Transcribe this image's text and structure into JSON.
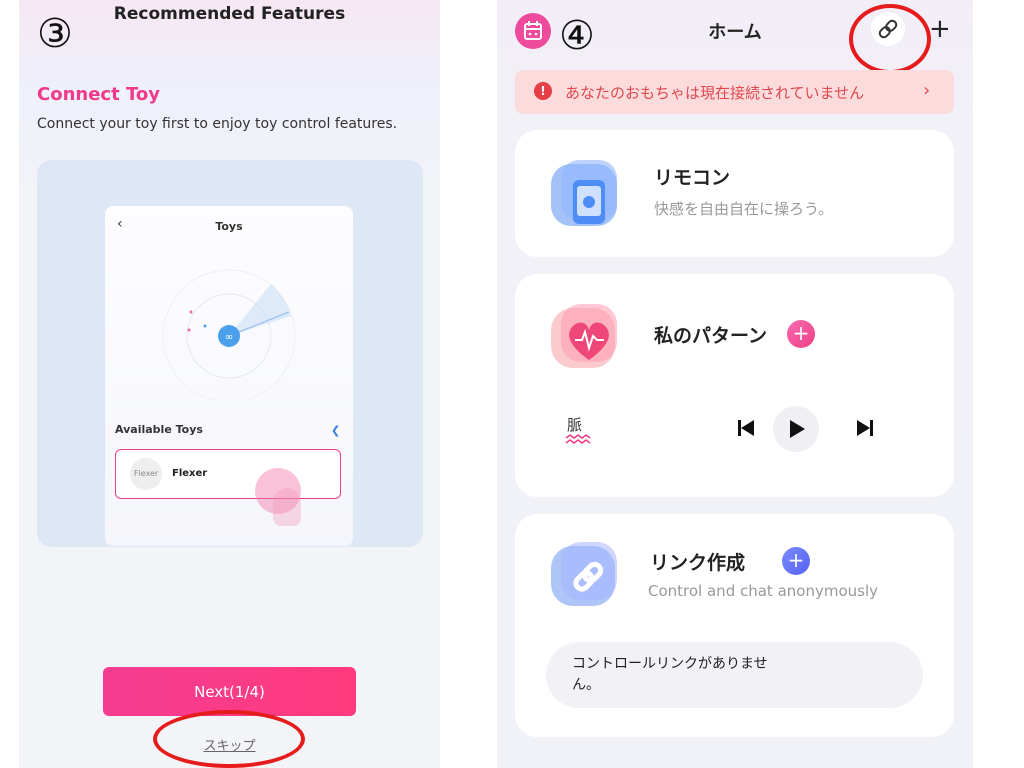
{
  "left": {
    "step_marker": "③",
    "header_title": "Recommended Features",
    "feature_title": "Connect Toy",
    "feature_desc": "Connect your toy first to enjoy toy control features.",
    "illustration": {
      "screen_title": "Toys",
      "available_label": "Available Toys",
      "toy_avatar": "Flexer",
      "toy_name": "Flexer"
    },
    "next_label": "Next(1/4)",
    "skip_label": "スキップ"
  },
  "right": {
    "step_marker": "④",
    "header_title": "ホーム",
    "alert_text": "あなたのおもちゃは現在接続されていません",
    "alert_icon": "!",
    "cards": {
      "remote": {
        "title": "リモコン",
        "subtitle": "快感を自由自在に操ろう。"
      },
      "pattern": {
        "title": "私のパターン",
        "pattern_label": "脈"
      },
      "link": {
        "title": "リンク作成",
        "subtitle": "Control and chat anonymously",
        "empty_text": "コントロールリンクがありません。"
      }
    },
    "icons": [
      "calendar-icon",
      "link-icon",
      "plus-icon",
      "chevron-right-icon",
      "previous-icon",
      "play-icon",
      "next-icon",
      "wave-icon"
    ]
  },
  "colors": {
    "accent_pink": "#f0398a",
    "alert_red": "#e0484f",
    "alert_bg": "#fbdbdc",
    "annotation_red": "#e61c1c",
    "blue_accent": "#5361f0"
  }
}
